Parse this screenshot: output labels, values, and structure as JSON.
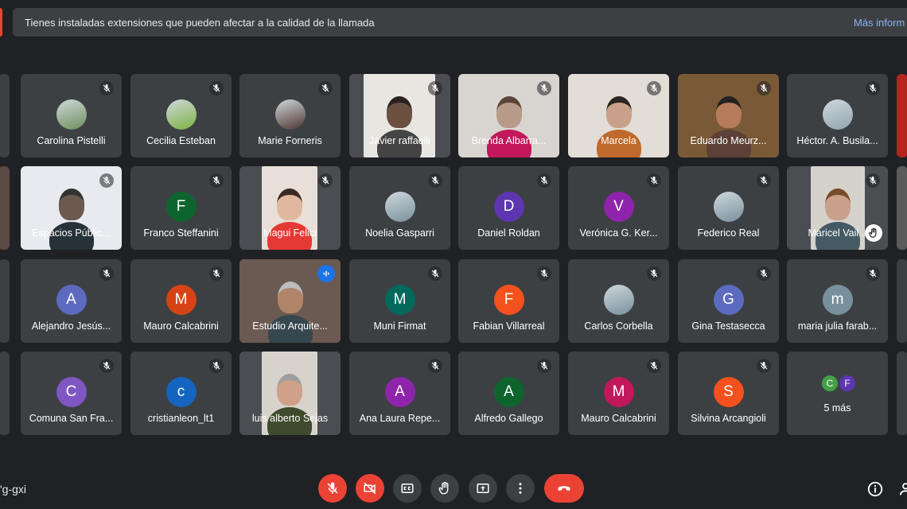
{
  "banner": {
    "message": "Tienes instaladas extensiones que pueden afectar a la calidad de la llamada",
    "link": "Más inform"
  },
  "colors": {
    "background": "#202124",
    "tile": "#3c4043",
    "accent": "#8ab4f8",
    "danger": "#ea4335"
  },
  "participants": [
    {
      "name": "Carolina Pistelli",
      "kind": "photo",
      "icon": "mic-off-icon"
    },
    {
      "name": "Cecilia Esteban",
      "kind": "photo",
      "icon": "mic-off-icon"
    },
    {
      "name": "Marie Forneris",
      "kind": "photo",
      "icon": "mic-off-icon"
    },
    {
      "name": "Javier raffaelli",
      "kind": "video",
      "icon": "mic-off-icon"
    },
    {
      "name": "Brenda Albarra...",
      "kind": "video",
      "icon": "mic-off-icon"
    },
    {
      "name": "Marcela",
      "kind": "video",
      "icon": "mic-off-icon"
    },
    {
      "name": "Eduardo Meurz...",
      "kind": "video",
      "icon": "mic-off-icon"
    },
    {
      "name": "Héctor. A. Busila...",
      "kind": "photo",
      "icon": "mic-off-icon"
    },
    {
      "name": "Espacios Públic...",
      "kind": "video",
      "icon": "mic-off-icon"
    },
    {
      "name": "Franco Steffanini",
      "kind": "letter",
      "initial": "F",
      "color": "#0d652d",
      "icon": "mic-off-icon"
    },
    {
      "name": "Magui Felici",
      "kind": "video",
      "icon": "mic-off-icon"
    },
    {
      "name": "Noelia Gasparri",
      "kind": "photo",
      "icon": "mic-off-icon"
    },
    {
      "name": "Daniel Roldan",
      "kind": "letter",
      "initial": "D",
      "color": "#5e35b1",
      "icon": "mic-off-icon"
    },
    {
      "name": "Verónica G. Ker...",
      "kind": "letter",
      "initial": "V",
      "color": "#8e24aa",
      "icon": "mic-off-icon"
    },
    {
      "name": "Federico Real",
      "kind": "photo",
      "icon": "mic-off-icon"
    },
    {
      "name": "Maricel Vail...",
      "kind": "video",
      "icon": "mic-off-icon",
      "hand": "raised-hand-icon"
    },
    {
      "name": "Alejandro Jesús...",
      "kind": "letter",
      "initial": "A",
      "color": "#5c6bc0",
      "icon": "mic-off-icon"
    },
    {
      "name": "Mauro Calcabrini",
      "kind": "letter",
      "initial": "M",
      "color": "#d84315",
      "icon": "mic-off-icon"
    },
    {
      "name": "Estudio Arquite...",
      "kind": "video",
      "icon": "audio-level-icon"
    },
    {
      "name": "Muni Firmat",
      "kind": "letter",
      "initial": "M",
      "color": "#00695c",
      "icon": "mic-off-icon"
    },
    {
      "name": "Fabian Villarreal",
      "kind": "letter",
      "initial": "F",
      "color": "#f4511e",
      "icon": "mic-off-icon"
    },
    {
      "name": "Carlos Corbella",
      "kind": "photo",
      "icon": "mic-off-icon"
    },
    {
      "name": "Gina Testasecca",
      "kind": "letter",
      "initial": "G",
      "color": "#5c6bc0",
      "icon": "mic-off-icon"
    },
    {
      "name": "maria julia farab...",
      "kind": "letter",
      "initial": "m",
      "color": "#78909c",
      "icon": "mic-off-icon"
    },
    {
      "name": "Comuna San Fra...",
      "kind": "letter",
      "initial": "C",
      "color": "#7e57c2",
      "icon": "mic-off-icon"
    },
    {
      "name": "cristianleon_lt1",
      "kind": "letter",
      "initial": "c",
      "color": "#1565c0",
      "icon": "mic-off-icon"
    },
    {
      "name": "luis alberto Sejas",
      "kind": "video",
      "icon": "none"
    },
    {
      "name": "Ana Laura Repe...",
      "kind": "letter",
      "initial": "A",
      "color": "#8e24aa",
      "icon": "mic-off-icon"
    },
    {
      "name": "Alfredo Gallego",
      "kind": "letter",
      "initial": "A",
      "color": "#0d652d",
      "icon": "mic-off-icon"
    },
    {
      "name": "Mauro Calcabrini",
      "kind": "letter",
      "initial": "M",
      "color": "#c2185b",
      "icon": "mic-off-icon"
    },
    {
      "name": "Silvina Arcangioli",
      "kind": "letter",
      "initial": "S",
      "color": "#f4511e",
      "icon": "mic-off-icon"
    }
  ],
  "more": {
    "label": "5 más",
    "initials": [
      {
        "initial": "C",
        "color": "#43a047"
      },
      {
        "initial": "F",
        "color": "#5e35b1"
      }
    ]
  },
  "controls": {
    "meeting_code": "'g-gxi",
    "buttons": [
      {
        "name": "mic-off-button",
        "icon": "mic-off-icon",
        "color": "#ea4335"
      },
      {
        "name": "camera-off-button",
        "icon": "camera-off-icon",
        "color": "#ea4335"
      },
      {
        "name": "captions-button",
        "icon": "captions-icon",
        "color": "#3c4043"
      },
      {
        "name": "raise-hand-button",
        "icon": "hand-icon",
        "color": "#3c4043"
      },
      {
        "name": "present-button",
        "icon": "present-screen-icon",
        "color": "#3c4043"
      },
      {
        "name": "more-options-button",
        "icon": "more-vert-icon",
        "color": "#3c4043"
      },
      {
        "name": "end-call-button",
        "icon": "hang-up-icon",
        "color": "#ea4335"
      }
    ]
  }
}
